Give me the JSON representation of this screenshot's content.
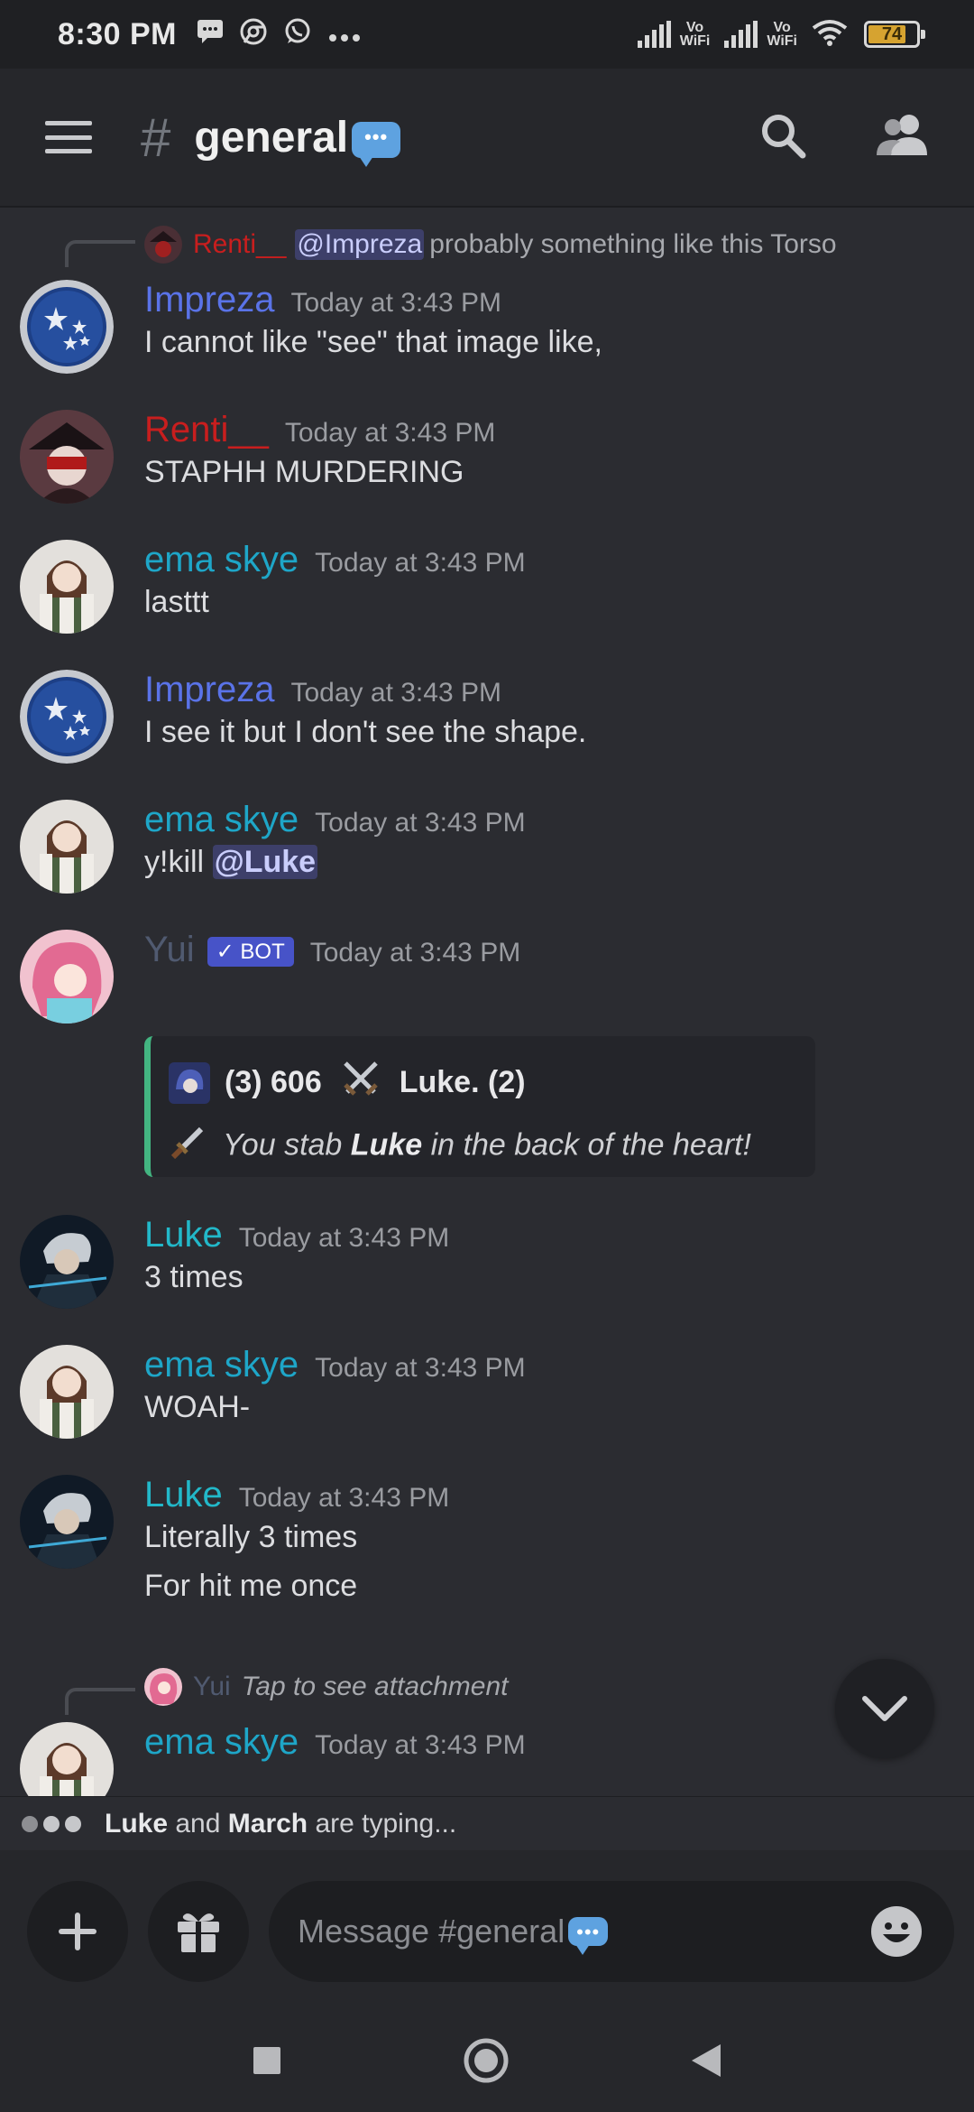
{
  "status_bar": {
    "time": "8:30 PM",
    "notification_icons": [
      "message-icon",
      "chrome-icon",
      "whatsapp-icon",
      "more-icon"
    ],
    "vowifi_label_1": "Vo\nWiFi",
    "vowifi_label_2": "Vo\nWiFi",
    "battery_level": "74"
  },
  "header": {
    "hash": "#",
    "channel_name": "general"
  },
  "messages": [
    {
      "reply_to": {
        "author": "Renti__",
        "mention": "@Impreza",
        "text": "probably something like this Torso"
      },
      "author": "Impreza",
      "timestamp": "Today at 3:43 PM",
      "text": "I cannot like \"see\" that image like,"
    },
    {
      "author": "Renti__",
      "timestamp": "Today at 3:43 PM",
      "text": "STAPHH MURDERING"
    },
    {
      "author": "ema skye",
      "timestamp": "Today at 3:43 PM",
      "text": "lasttt"
    },
    {
      "author": "Impreza",
      "timestamp": "Today at 3:43 PM",
      "text": "I see it but I don't see the shape."
    },
    {
      "author": "ema skye",
      "timestamp": "Today at 3:43 PM",
      "text_prefix": "y!kill ",
      "mention": "@Luke"
    },
    {
      "author": "Yui",
      "bot_badge": "✓ BOT",
      "timestamp": "Today at 3:43 PM",
      "embed": {
        "title": "(3) 606",
        "title_tail": "Luke. (2)",
        "body_prefix": "You stab ",
        "body_bold": "Luke",
        "body_suffix": " in the back of the heart!"
      }
    },
    {
      "author": "Luke",
      "timestamp": "Today at 3:43 PM",
      "text": "3 times"
    },
    {
      "author": "ema skye",
      "timestamp": "Today at 3:43 PM",
      "text": "WOAH-"
    },
    {
      "author": "Luke",
      "timestamp": "Today at 3:43 PM",
      "text": "Literally 3 times",
      "text2": "For hit me once"
    },
    {
      "reply_to": {
        "author": "Yui",
        "text": "Tap to see attachment"
      },
      "author": "ema skye",
      "timestamp": "Today at 3:43 PM"
    }
  ],
  "typing": {
    "user1": "Luke",
    "joiner": " and ",
    "user2": "March",
    "suffix": " are typing..."
  },
  "composer": {
    "placeholder": "Message #general"
  },
  "colors": {
    "impreza": "#5a73e8",
    "renti": "#c81e1e",
    "ema": "#1ea6c8",
    "yui": "#505a70",
    "luke": "#22b8c9",
    "embed_accent": "#43b581"
  }
}
